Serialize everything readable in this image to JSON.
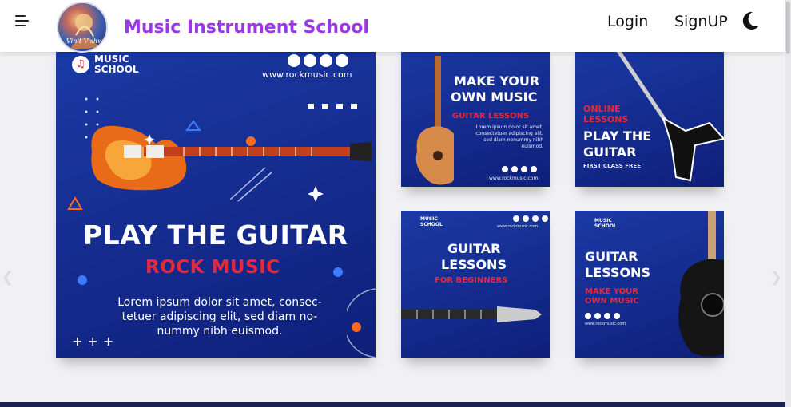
{
  "header": {
    "brand_name": "Music Instrument School",
    "logo_caption": "Vinit Vishwakarma",
    "login_label": "Login",
    "signup_label": "SignUP",
    "theme_toggle_icon": "moon-icon",
    "menu_icon": "menu-icon"
  },
  "carousel": {
    "prev_icon": "chevron-left-icon",
    "next_icon": "chevron-right-icon",
    "featured": {
      "brand_line1": "MUSIC",
      "brand_line2": "SCHOOL",
      "website": "www.rockmusic.com",
      "title": "PLAY THE GUITAR",
      "subtitle": "ROCK MUSIC",
      "body": "Lorem ipsum dolor sit amet, consec-tetuer adipiscing elit, sed diam no-nummy nibh euismod."
    },
    "cards": [
      {
        "title_line1": "MAKE YOUR",
        "title_line2": "OWN MUSIC",
        "subtitle": "GUITAR LESSONS",
        "body": "Lorem ipsum dolor sit amet, consectetuer adipiscing elit, sed diam nonummy nibh euismod.",
        "website": "www.rockmusic.com"
      },
      {
        "tag_line1": "ONLINE",
        "tag_line2": "LESSONS",
        "title_line1": "PLAY THE",
        "title_line2": "GUITAR",
        "subtitle": "FIRST CLASS FREE"
      },
      {
        "brand_line1": "MUSIC",
        "brand_line2": "SCHOOL",
        "website": "www.rockmusic.com",
        "title_line1": "GUITAR",
        "title_line2": "LESSONS",
        "subtitle": "FOR BEGINNERS"
      },
      {
        "brand_line1": "MUSIC",
        "brand_line2": "SCHOOL",
        "title_line1": "GUITAR",
        "title_line2": "LESSONS",
        "subtitle_line1": "MAKE YOUR",
        "subtitle_line2": "OWN MUSIC",
        "website": "www.rockmusic.com"
      }
    ]
  },
  "colors": {
    "brand_purple": "#9b37e6",
    "card_blue": "#1b3aa5",
    "accent_red": "#e8283a",
    "footer_navy": "#1a2452"
  }
}
